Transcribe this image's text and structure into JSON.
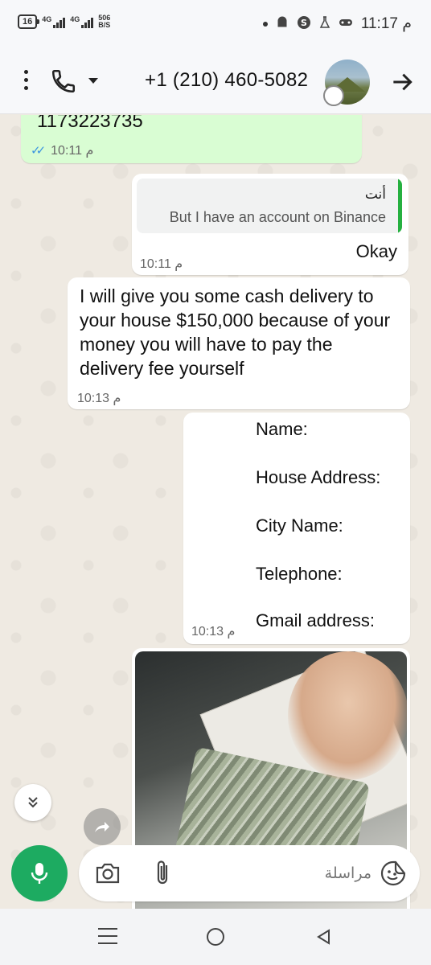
{
  "status_bar": {
    "battery": "16",
    "network1": "4G",
    "network2": "4G",
    "speed_value": "506",
    "speed_unit": "B/S",
    "time": "11:17 م",
    "icons": [
      "dot-icon",
      "android-icon",
      "s-app-icon",
      "lab-flask-icon",
      "gamepad-icon"
    ]
  },
  "header": {
    "contact_name": "+1 (210) 460-5082",
    "icons": [
      "more-vert-icon",
      "phone-icon",
      "dropdown-arrow-icon",
      "avatar",
      "back-arrow-icon"
    ]
  },
  "messages": [
    {
      "type": "outgoing",
      "text": "1173223735",
      "time": "10:11 م",
      "status": "read"
    },
    {
      "type": "outgoing",
      "quote_author": "أنت",
      "quote_text": "But I have an account on Binance",
      "text": "Okay",
      "time": "10:11 م"
    },
    {
      "type": "incoming",
      "text": "I will give you some cash delivery to your house $150,000 because of your money you will have to pay the delivery fee yourself",
      "time": "10:13 م"
    },
    {
      "type": "incoming",
      "lines": [
        "Name:",
        "House Address:",
        "City Name:",
        "Telephone:",
        "Gmail address:"
      ],
      "time": "10:13 م"
    },
    {
      "type": "incoming",
      "media": "photo"
    }
  ],
  "composer": {
    "placeholder": "مراسلة",
    "icons": [
      "mic-icon",
      "camera-icon",
      "paperclip-icon",
      "sticker-icon"
    ]
  },
  "nav": {
    "icons": [
      "recent-apps-icon",
      "home-icon",
      "back-icon"
    ]
  },
  "colors": {
    "outgoing_bubble": "#d9fdd3",
    "incoming_bubble": "#ffffff",
    "accent_green": "#1dab61",
    "read_ticks": "#3b95e0",
    "chat_bg": "#efeae2"
  }
}
